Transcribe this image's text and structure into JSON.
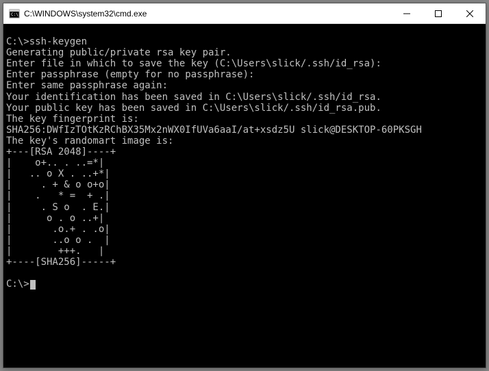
{
  "window": {
    "title": "C:\\WINDOWS\\system32\\cmd.exe"
  },
  "terminal": {
    "lines": [
      "",
      "C:\\>ssh-keygen",
      "Generating public/private rsa key pair.",
      "Enter file in which to save the key (C:\\Users\\slick/.ssh/id_rsa):",
      "Enter passphrase (empty for no passphrase):",
      "Enter same passphrase again:",
      "Your identification has been saved in C:\\Users\\slick/.ssh/id_rsa.",
      "Your public key has been saved in C:\\Users\\slick/.ssh/id_rsa.pub.",
      "The key fingerprint is:",
      "SHA256:DWfIzTOtKzRChBX35Mx2nWX0IfUVa6aaI/at+xsdz5U slick@DESKTOP-60PKSGH",
      "The key's randomart image is:",
      "+---[RSA 2048]----+",
      "|    o+.. . ..=*|",
      "|   .. o X . ..+*|",
      "|     . + & o o+o|",
      "|    .   * =  + .|",
      "|     . S o  . E.|",
      "|      o . o ..+|",
      "|       .o.+ . .o|",
      "|       ..o o .  |",
      "|        +++.   |",
      "+----[SHA256]-----+",
      "",
      "C:\\>"
    ]
  }
}
